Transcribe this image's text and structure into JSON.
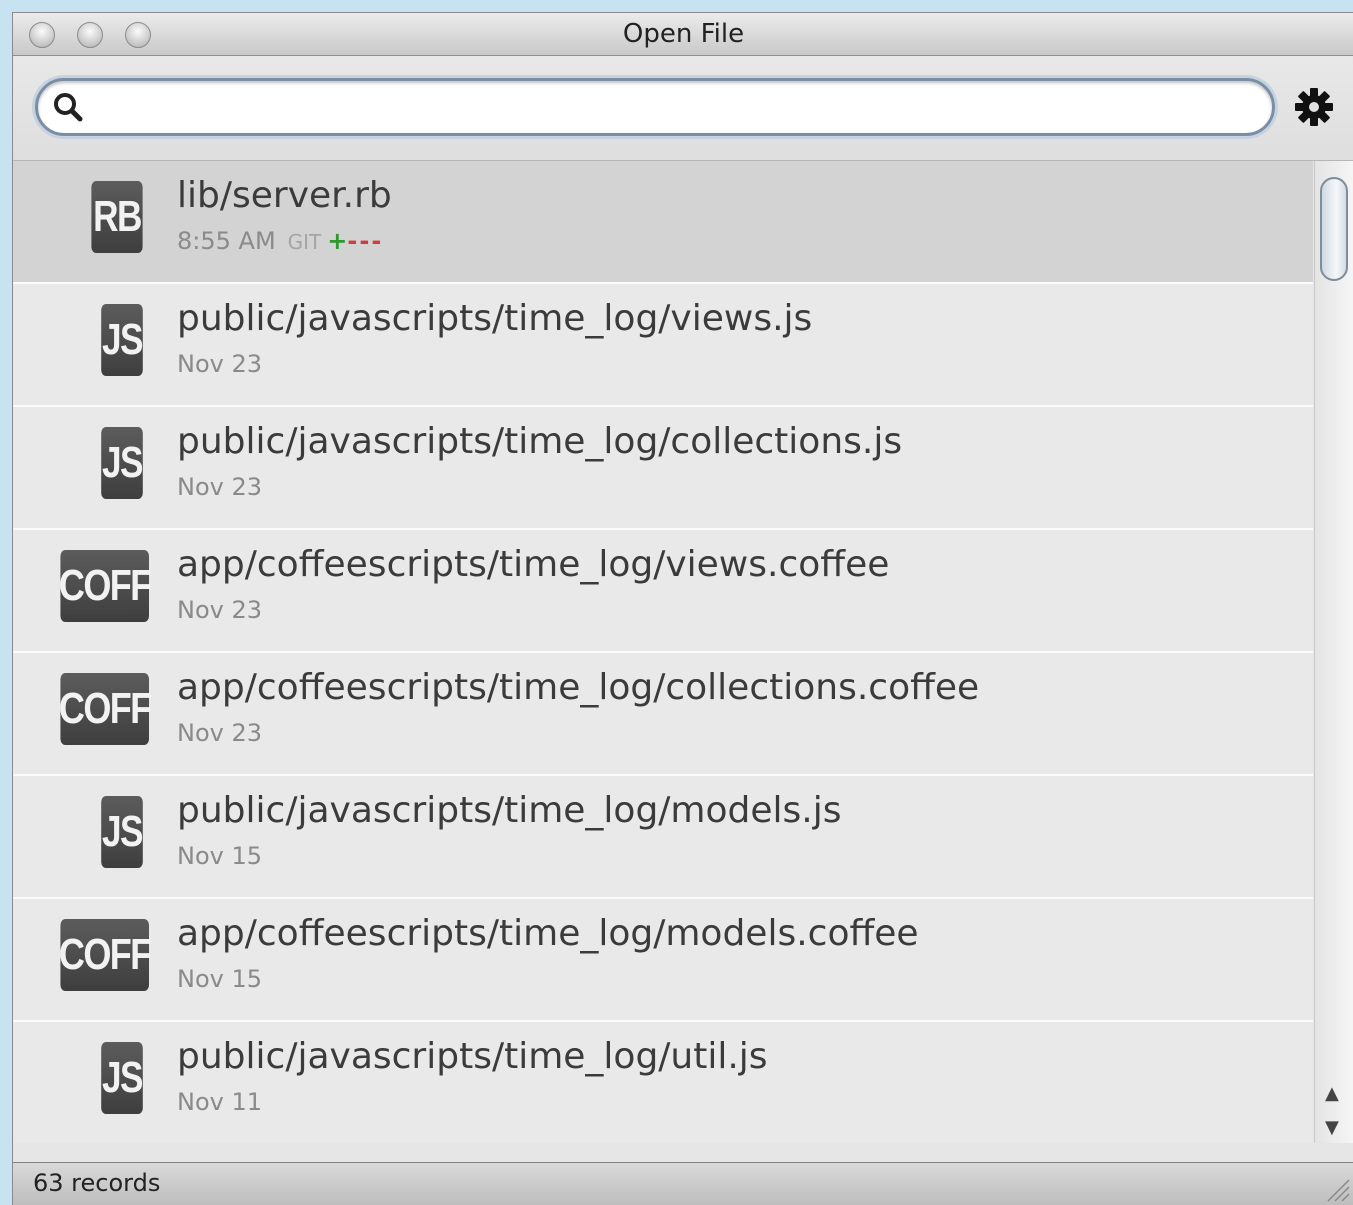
{
  "window": {
    "title": "Open File"
  },
  "search": {
    "value": "",
    "placeholder": ""
  },
  "files": [
    {
      "type_badge": "RB",
      "path": "lib/server.rb",
      "date": "8:55 AM",
      "vcs": "GIT",
      "vcs_added": "+",
      "vcs_removed": "---"
    },
    {
      "type_badge": "JS",
      "path": "public/javascripts/time_log/views.js",
      "date": "Nov 23"
    },
    {
      "type_badge": "JS",
      "path": "public/javascripts/time_log/collections.js",
      "date": "Nov 23"
    },
    {
      "type_badge": "COFF",
      "path": "app/coffeescripts/time_log/views.coffee",
      "date": "Nov 23"
    },
    {
      "type_badge": "COFF",
      "path": "app/coffeescripts/time_log/collections.coffee",
      "date": "Nov 23"
    },
    {
      "type_badge": "JS",
      "path": "public/javascripts/time_log/models.js",
      "date": "Nov 15"
    },
    {
      "type_badge": "COFF",
      "path": "app/coffeescripts/time_log/models.coffee",
      "date": "Nov 15"
    },
    {
      "type_badge": "JS",
      "path": "public/javascripts/time_log/util.js",
      "date": "Nov 11"
    }
  ],
  "status": {
    "records": "63 records"
  },
  "colors": {
    "vcs_added": "#2d9a2d",
    "vcs_removed": "#d23c3c",
    "badge": "#4a4a4a",
    "selection": "#d3d3d3"
  },
  "icons": {
    "search": "search-icon",
    "settings": "gear-icon"
  }
}
